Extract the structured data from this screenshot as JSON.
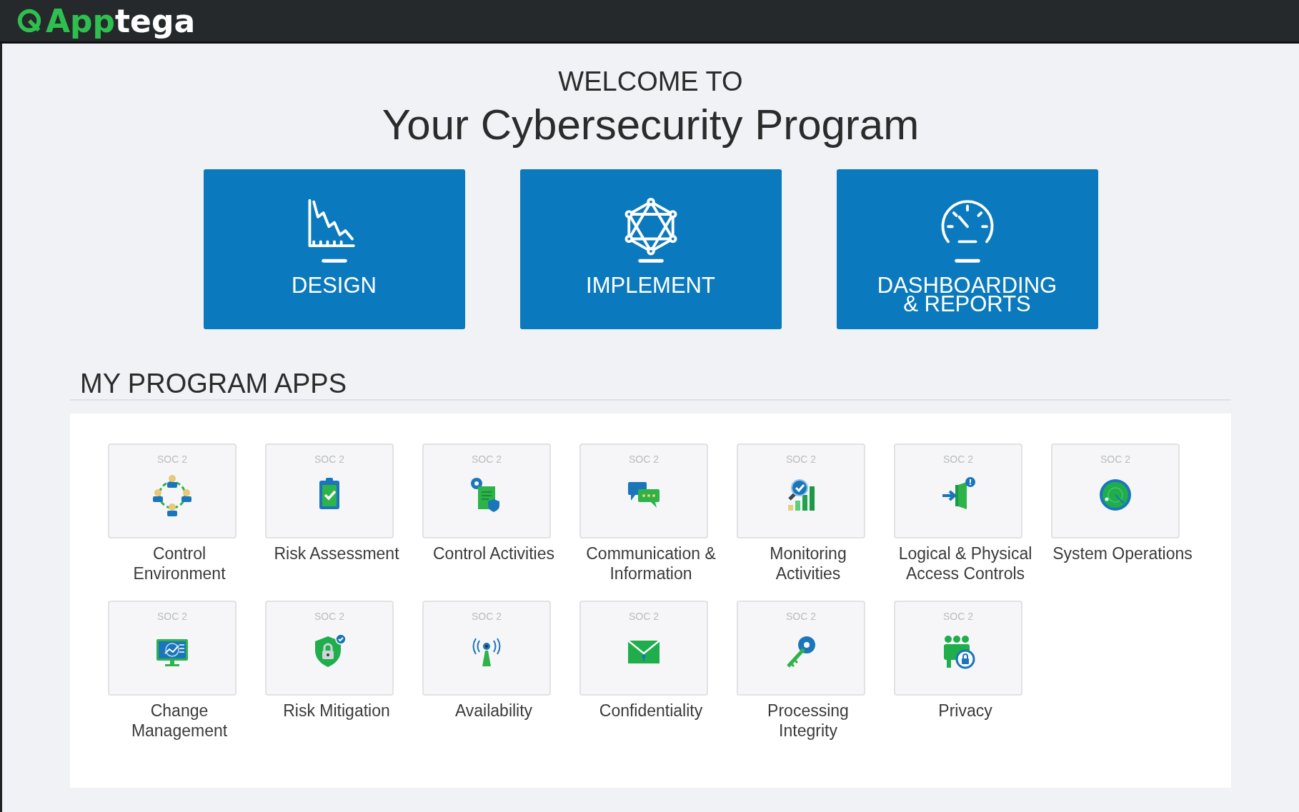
{
  "header": {
    "logo_green": "App",
    "logo_white": "tega"
  },
  "welcome": {
    "kicker": "WELCOME TO",
    "title": "Your Cybersecurity Program"
  },
  "modules": [
    {
      "label": "DESIGN"
    },
    {
      "label": "IMPLEMENT"
    },
    {
      "label": "DASHBOARDING & REPORTS"
    }
  ],
  "apps_section": {
    "title": "MY PROGRAM APPS",
    "apps": [
      {
        "tag": "SOC 2",
        "label": "Control Environment"
      },
      {
        "tag": "SOC 2",
        "label": "Risk Assessment"
      },
      {
        "tag": "SOC 2",
        "label": "Control Activities"
      },
      {
        "tag": "SOC 2",
        "label": "Communication & Information"
      },
      {
        "tag": "SOC 2",
        "label": "Monitoring Activities"
      },
      {
        "tag": "SOC 2",
        "label": "Logical & Physical Access Controls"
      },
      {
        "tag": "SOC 2",
        "label": "System Operations"
      },
      {
        "tag": "SOC 2",
        "label": "Change Management"
      },
      {
        "tag": "SOC 2",
        "label": "Risk Mitigation"
      },
      {
        "tag": "SOC 2",
        "label": "Availability"
      },
      {
        "tag": "SOC 2",
        "label": "Confidentiality"
      },
      {
        "tag": "SOC 2",
        "label": "Processing Integrity"
      },
      {
        "tag": "SOC 2",
        "label": "Privacy"
      }
    ]
  }
}
